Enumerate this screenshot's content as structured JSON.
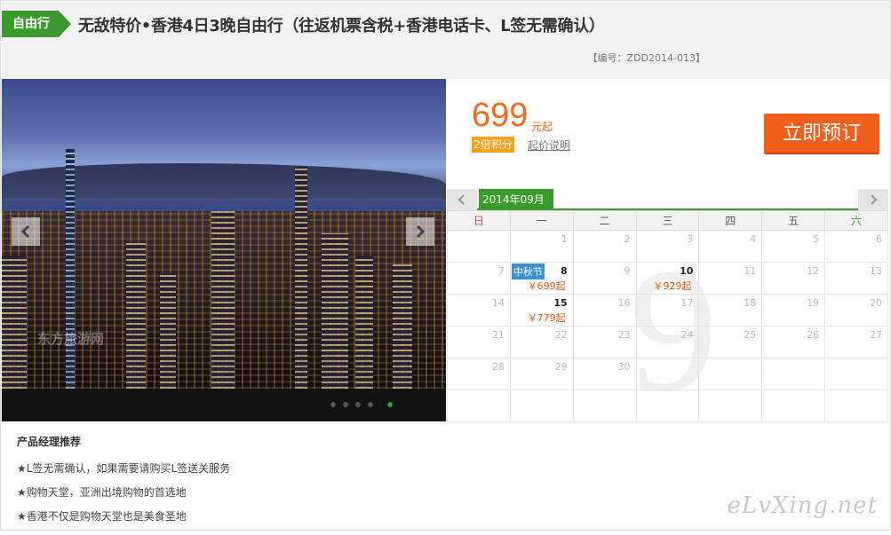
{
  "header": {
    "badge": "自由行",
    "title": "无敌特价•香港4日3晚自由行（往返机票含税+香港电话卡、L签无需确认）",
    "code": "【编号：ZDD2014-013】"
  },
  "gallery": {
    "watermark": "东方旅游网",
    "prev_icon": "chevron-left-icon",
    "next_icon": "chevron-right-icon",
    "slide_count": 5,
    "active_slide": 5
  },
  "pricing": {
    "price": "699",
    "unit": "元起",
    "points": "2倍积分",
    "note": "起价说明",
    "book_label": "立即预订"
  },
  "calendar": {
    "month_label": "2014年09月",
    "big_month": "9",
    "weekdays": [
      "日",
      "一",
      "二",
      "三",
      "四",
      "五",
      "六"
    ],
    "weeks": [
      [
        {
          "d": ""
        },
        {
          "d": "1"
        },
        {
          "d": "2"
        },
        {
          "d": "3"
        },
        {
          "d": "4"
        },
        {
          "d": "5"
        },
        {
          "d": "6"
        }
      ],
      [
        {
          "d": "7"
        },
        {
          "d": "8",
          "price": "￥699起",
          "tag": "中秋节"
        },
        {
          "d": "9"
        },
        {
          "d": "10",
          "price": "￥929起"
        },
        {
          "d": "11"
        },
        {
          "d": "12"
        },
        {
          "d": "13"
        }
      ],
      [
        {
          "d": "14"
        },
        {
          "d": "15",
          "price": "￥779起"
        },
        {
          "d": "16"
        },
        {
          "d": "17"
        },
        {
          "d": "18"
        },
        {
          "d": "19"
        },
        {
          "d": "20"
        }
      ],
      [
        {
          "d": "21"
        },
        {
          "d": "22"
        },
        {
          "d": "23"
        },
        {
          "d": "24"
        },
        {
          "d": "25"
        },
        {
          "d": "26"
        },
        {
          "d": "27"
        }
      ],
      [
        {
          "d": "28"
        },
        {
          "d": "29"
        },
        {
          "d": "30"
        },
        {
          "d": ""
        },
        {
          "d": ""
        },
        {
          "d": ""
        },
        {
          "d": ""
        }
      ],
      [
        {
          "d": ""
        },
        {
          "d": ""
        },
        {
          "d": ""
        },
        {
          "d": ""
        },
        {
          "d": ""
        },
        {
          "d": ""
        },
        {
          "d": ""
        }
      ]
    ]
  },
  "recommend": {
    "title": "产品经理推荐",
    "items": [
      "★L签无需确认，如果需要请购买L签送关服务",
      "★购物天堂，亚洲出境购物的首选地",
      "★香港不仅是购物天堂也是美食圣地"
    ]
  },
  "logo": "eLvXing.net",
  "colors": {
    "accent": "#3a9b2c",
    "price": "#f26b1d",
    "book": "#f0601c"
  }
}
